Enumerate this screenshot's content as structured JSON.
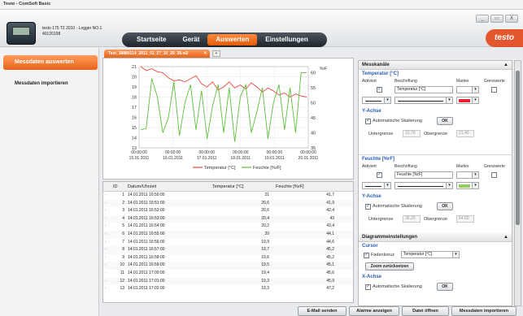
{
  "window": {
    "title": "Testo - ComSoft Basic",
    "controls": [
      "_",
      "▭",
      "X"
    ]
  },
  "device": {
    "line1": "testo 175 T2 2010 - Logger NO.1",
    "line2": "40120198"
  },
  "nav": {
    "items": [
      "Startseite",
      "Gerät",
      "Auswerten",
      "Einstellungen"
    ],
    "active": 2
  },
  "logo": "testo",
  "sidebar": {
    "items": [
      "Messdaten auswerten",
      "Messdaten importieren"
    ]
  },
  "tab": {
    "label": "Test_38880114_2011_01_27_10_29_38.vi2",
    "close": "×",
    "add": "+"
  },
  "chart_data": {
    "type": "line",
    "x": [
      "15.01.2011",
      "16.01.2011",
      "17.01.2011",
      "18.01.2011",
      "19.01.2011",
      "20.01.2011"
    ],
    "x_time_labels": [
      "00:00:00",
      "00:00:00",
      "00:00:00",
      "00:00:00",
      "00:00:00",
      "00:00:00"
    ],
    "y_left_ticks": [
      "21",
      "20",
      "19",
      "18",
      "17",
      "16",
      "15",
      "14",
      "13"
    ],
    "y_right_ticks": [
      "60",
      "55",
      "50",
      "45",
      "40",
      "35"
    ],
    "y_right_unit": "%rF",
    "ylim": [
      13,
      21
    ],
    "ylim_right": [
      35,
      62
    ],
    "series": [
      {
        "name": "Temperatur [°C]",
        "color": "#e8493c",
        "axis": "left",
        "values": [
          21,
          20.6,
          20.8,
          20.5,
          20.4,
          19.9,
          19.6,
          19.7,
          19.5,
          19.8,
          20.1,
          19.3,
          19.0,
          19.5,
          18.7,
          19.0,
          19.5,
          18.9,
          19.2,
          18.8,
          19.4,
          19.0,
          18.5,
          18.9,
          18.6,
          18.2,
          18.4,
          18.0,
          18.3,
          18.1,
          18.0
        ]
      },
      {
        "name": "Feuchte [%rF]",
        "color": "#5fbf3c",
        "axis": "right",
        "values": [
          41,
          41.5,
          58,
          52,
          40,
          45,
          57,
          39,
          50,
          56,
          41,
          54,
          38,
          49,
          56,
          40,
          55,
          37,
          52,
          56,
          40,
          47,
          55,
          38,
          50,
          56,
          41,
          55,
          40,
          60,
          60
        ]
      }
    ]
  },
  "table": {
    "headers": [
      "ID",
      "Datum/Uhrzeit",
      "Temperatur [°C]",
      "Feuchte [%rF]"
    ],
    "rows": [
      [
        "1",
        "14.01.2011 16:50:00",
        "21",
        "41,7"
      ],
      [
        "2",
        "14.01.2011 16:51:00",
        "20,6",
        "41,9"
      ],
      [
        "3",
        "14.01.2011 16:52:00",
        "20,6",
        "42,4"
      ],
      [
        "4",
        "14.01.2011 16:53:00",
        "20,4",
        "43"
      ],
      [
        "5",
        "14.01.2011 16:54:00",
        "20,2",
        "43,4"
      ],
      [
        "6",
        "14.01.2011 16:55:00",
        "20",
        "44,1"
      ],
      [
        "7",
        "14.01.2011 16:56:00",
        "19,9",
        "44,6"
      ],
      [
        "8",
        "14.01.2011 16:57:00",
        "19,7",
        "45,2"
      ],
      [
        "9",
        "14.01.2011 16:58:00",
        "19,6",
        "45,2"
      ],
      [
        "10",
        "14.01.2011 16:59:00",
        "19,5",
        "45,1"
      ],
      [
        "11",
        "14.01.2011 17:00:00",
        "19,4",
        "45,6"
      ],
      [
        "12",
        "14.01.2011 17:01:00",
        "19,3",
        "45,9"
      ],
      [
        "13",
        "14.01.2011 17:02:00",
        "19,3",
        "47,2"
      ]
    ]
  },
  "buttons": {
    "email": "E-Mail senden",
    "alarms": "Alarme anzeigen",
    "open": "Datei öffnen",
    "import": "Messdaten importieren"
  },
  "panel": {
    "title": "Messkanäle",
    "temp": {
      "title": "Temperatur [°C]",
      "col_active": "Aktiviert",
      "col_label": "Beschriftung",
      "col_marker": "Marker",
      "col_limits": "Grenzwerte",
      "label_value": "Temperatur [°C]",
      "marker_color": "#e8202a",
      "yaxis": "Y-Achse",
      "autoscale": "Automatische Skalierung",
      "ok": "OK",
      "lower_label": "Untergrenze",
      "lower": "12,70",
      "upper_label": "Obergrenze",
      "upper": "21,40"
    },
    "hum": {
      "title": "Feuchte [%rF]",
      "col_active": "Aktiviert",
      "col_label": "Beschriftung",
      "col_marker": "Marker",
      "col_limits": "Grenzwerte",
      "label_value": "Feuchte [%rF]",
      "marker_color": "#8fcf5a",
      "yaxis": "Y-Achse",
      "autoscale": "Automatische Skalierung",
      "ok": "OK",
      "lower_label": "Untergrenze",
      "lower": "36,20",
      "upper_label": "Obergrenze",
      "upper": "64,60"
    },
    "diagram": {
      "title": "Diagrammeinstellungen",
      "cursor": "Cursor",
      "crosshair": "Fadenkreuz",
      "crosshair_channel": "Temperatur [°C]",
      "zoom_reset": "Zoom zurücksetzen",
      "xaxis": "X-Achse",
      "autoscale": "Automatische Skalierung",
      "ok": "OK"
    }
  }
}
